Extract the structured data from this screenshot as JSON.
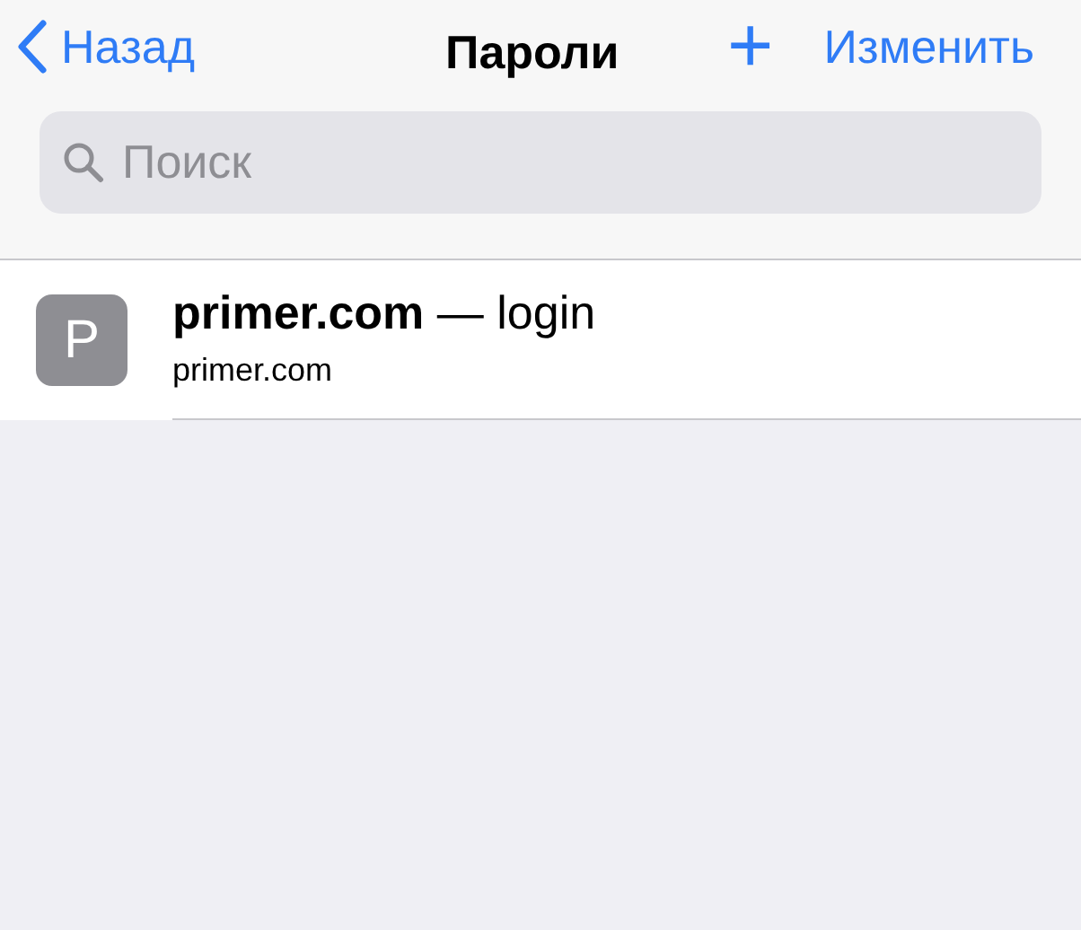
{
  "nav": {
    "back": "Назад",
    "title": "Пароли",
    "add": "+",
    "edit": "Изменить"
  },
  "search": {
    "placeholder": "Поиск"
  },
  "items": [
    {
      "initial": "P",
      "title": "**primer.com** — login",
      "subtitle": "primer.com"
    }
  ]
}
